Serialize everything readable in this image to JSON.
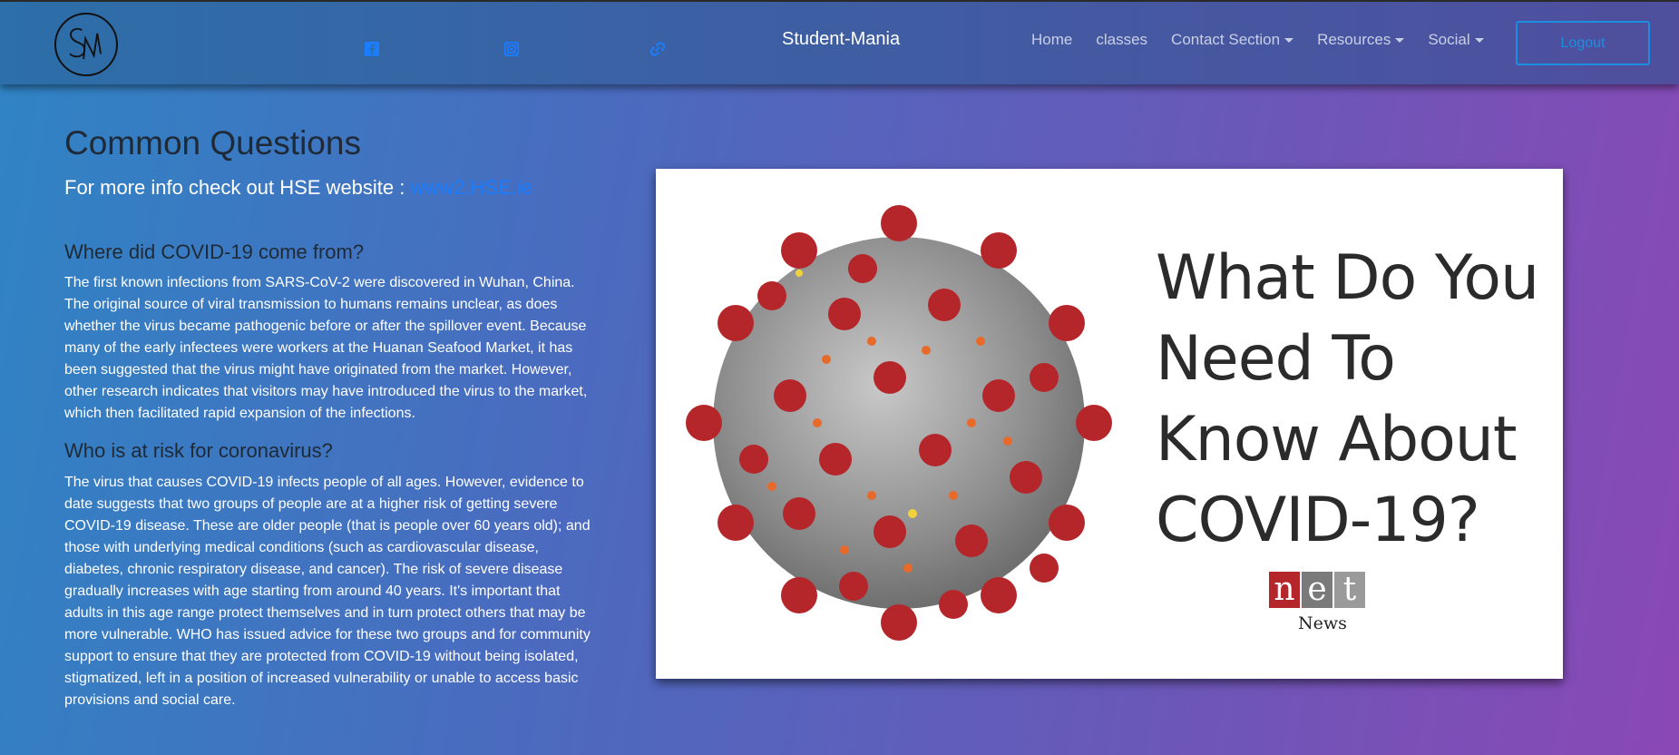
{
  "navbar": {
    "logo_text": "SM",
    "brand": "Student-Mania",
    "social_icons": [
      "facebook-icon",
      "instagram-icon",
      "link-icon"
    ],
    "links": [
      {
        "label": "Home",
        "dropdown": false
      },
      {
        "label": "classes",
        "dropdown": false
      },
      {
        "label": "Contact Section",
        "dropdown": true
      },
      {
        "label": "Resources",
        "dropdown": true
      },
      {
        "label": "Social",
        "dropdown": true
      }
    ],
    "logout_label": "Logout"
  },
  "main": {
    "title": "Common Questions",
    "info_prefix": "For more info check out HSE website : ",
    "info_link": "www2.HSE.ie",
    "sections": [
      {
        "heading": "Where did COVID-19 come from?",
        "body": "The first known infections from SARS-CoV-2 were discovered in Wuhan, China. The original source of viral transmission to humans remains unclear, as does whether the virus became pathogenic before or after the spillover event. Because many of the early infectees were workers at the Huanan Seafood Market, it has been suggested that the virus might have originated from the market. However, other research indicates that visitors may have introduced the virus to the market, which then facilitated rapid expansion of the infections."
      },
      {
        "heading": "Who is at risk for coronavirus?",
        "body": "The virus that causes COVID-19 infects people of all ages. However, evidence to date suggests that two groups of people are at a higher risk of getting severe COVID-19 disease. These are older people (that is people over 60 years old); and those with underlying medical conditions (such as cardiovascular disease, diabetes, chronic respiratory disease, and cancer). The risk of severe disease gradually increases with age starting from around 40 years. It's important that adults in this age range protect themselves and in turn protect others that may be more vulnerable. WHO has issued advice for these two groups and for community support to ensure that they are protected from COVID-19 without being isolated, stigmatized, left in a position of increased vulnerability or unable to access basic provisions and social care."
      }
    ]
  },
  "image_card": {
    "heading": "What Do You Need To Know About COVID-19?",
    "net_letters": [
      "n",
      "e",
      "t"
    ],
    "net_news": "News"
  },
  "colors": {
    "link_blue": "#1a7dff",
    "logout_blue": "#1a8fe0",
    "virus_red": "#b5262b",
    "virus_orange": "#e86a2a",
    "virus_gray": "#9a9a9a"
  }
}
